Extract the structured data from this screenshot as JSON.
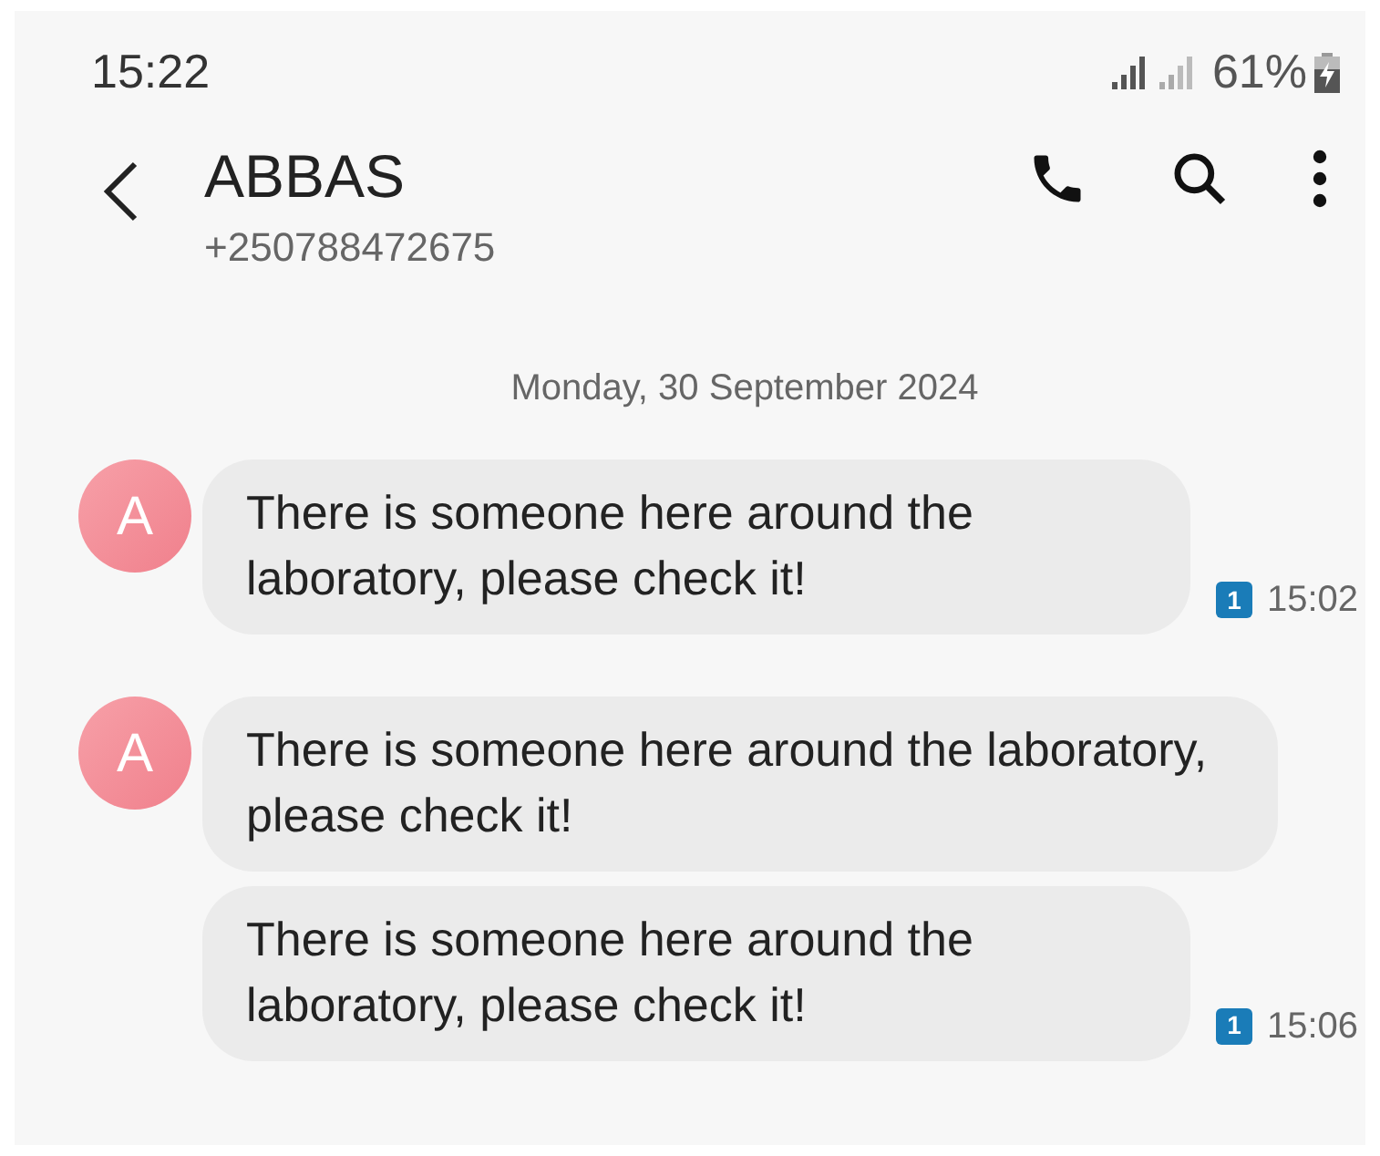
{
  "status_bar": {
    "time": "15:22",
    "battery": "61%"
  },
  "header": {
    "name": "ABBAS",
    "number": "+250788472675"
  },
  "date": "Monday, 30 September 2024",
  "messages": [
    {
      "avatar": "A",
      "text": "There is someone here around the laboratory, please check it!",
      "sim": "1",
      "time": "15:02"
    },
    {
      "avatar": "A",
      "text": "There is someone here around the laboratory, please check it!"
    },
    {
      "text": "There is someone here around the laboratory, please check it!",
      "sim": "1",
      "time": "15:06"
    }
  ]
}
